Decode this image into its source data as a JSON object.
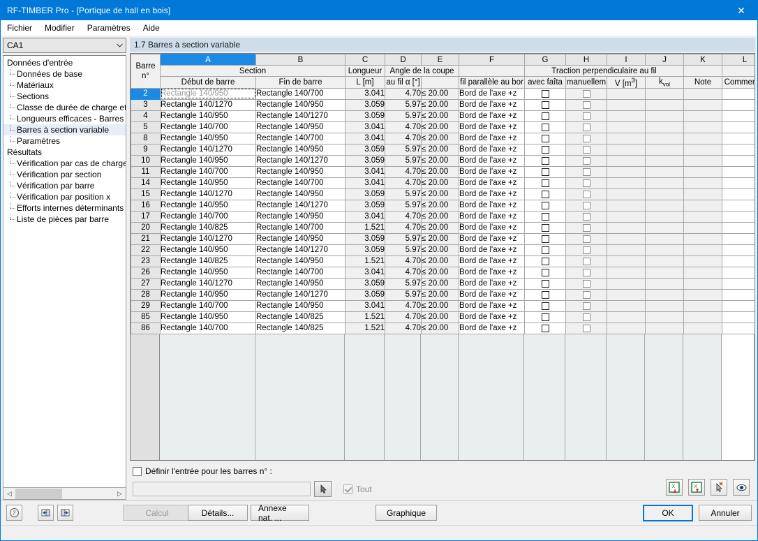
{
  "window": {
    "title": "RF-TIMBER Pro - [Portique de hall en bois]",
    "close_icon": "close-icon"
  },
  "menu": {
    "items": [
      {
        "label": "Fichier"
      },
      {
        "label": "Modifier"
      },
      {
        "label": "Paramètres"
      },
      {
        "label": "Aide"
      }
    ]
  },
  "sidebar": {
    "combo": {
      "value": "CA1",
      "arrow": "⌄"
    },
    "tree": [
      {
        "label": "Données d'entrée",
        "level": 0,
        "selected": false
      },
      {
        "label": "Données de base",
        "level": 1,
        "selected": false
      },
      {
        "label": "Matériaux",
        "level": 1,
        "selected": false
      },
      {
        "label": "Sections",
        "level": 1,
        "selected": false
      },
      {
        "label": "Classe de durée de charge et c",
        "level": 1,
        "selected": false
      },
      {
        "label": "Longueurs efficaces - Barres",
        "level": 1,
        "selected": false
      },
      {
        "label": "Barres à section variable",
        "level": 1,
        "selected": true
      },
      {
        "label": "Paramètres",
        "level": 1,
        "selected": false
      },
      {
        "label": "Résultats",
        "level": 0,
        "selected": false
      },
      {
        "label": "Vérification par cas de charge",
        "level": 1,
        "selected": false
      },
      {
        "label": "Vérification par section",
        "level": 1,
        "selected": false
      },
      {
        "label": "Vérification par barre",
        "level": 1,
        "selected": false
      },
      {
        "label": "Vérification par position x",
        "level": 1,
        "selected": false
      },
      {
        "label": "Efforts internes déterminants p",
        "level": 1,
        "selected": false
      },
      {
        "label": "Liste de pièces par barre",
        "level": 1,
        "selected": false
      }
    ]
  },
  "main": {
    "section_title": "1.7 Barres à section variable",
    "grid": {
      "column_letters": [
        "A",
        "B",
        "C",
        "D",
        "E",
        "F",
        "G",
        "H",
        "I",
        "J",
        "K",
        "L"
      ],
      "active_letter": "A",
      "corner_line1": "Barre",
      "corner_line2": "n°",
      "group_headers": {
        "section": "Section",
        "longueur": "Longueur",
        "angle": "Angle de la coupe",
        "traction": "Traction perpendiculaire au fil"
      },
      "sub_headers": {
        "debut": "Début de barre",
        "fin": "Fin de barre",
        "longueur_unit": "L [m]",
        "angle_unit": "au fil α [°]",
        "fil_parallele": "fil parallèle au bor",
        "avec_faita": "avec faîta",
        "manuellem": "manuellem",
        "volume": "V [m",
        "volume_sup": "3",
        "volume_end": "]",
        "kvol": "k",
        "kvol_sub": "vol",
        "note": "Note",
        "commentaire": "Commentai"
      },
      "rows": [
        {
          "no": "2",
          "debut": "Rectangle 140/950",
          "fin": "Rectangle 140/700",
          "longueur": "3.041",
          "angle": "4.70",
          "coupe": "≤ 20.00",
          "fil": "Bord de l'axe +z",
          "faita": false,
          "manuel": false,
          "v": "",
          "kvol": "",
          "note": "",
          "comment": "",
          "selected": true,
          "editing": true
        },
        {
          "no": "3",
          "debut": "Rectangle 140/1270",
          "fin": "Rectangle 140/950",
          "longueur": "3.059",
          "angle": "5.97",
          "coupe": "≤ 20.00",
          "fil": "Bord de l'axe +z",
          "faita": false,
          "manuel": false,
          "v": "",
          "kvol": "",
          "note": "",
          "comment": ""
        },
        {
          "no": "4",
          "debut": "Rectangle 140/950",
          "fin": "Rectangle 140/1270",
          "longueur": "3.059",
          "angle": "5.97",
          "coupe": "≤ 20.00",
          "fil": "Bord de l'axe +z",
          "faita": false,
          "manuel": false,
          "v": "",
          "kvol": "",
          "note": "",
          "comment": ""
        },
        {
          "no": "5",
          "debut": "Rectangle 140/700",
          "fin": "Rectangle 140/950",
          "longueur": "3.041",
          "angle": "4.70",
          "coupe": "≤ 20.00",
          "fil": "Bord de l'axe +z",
          "faita": false,
          "manuel": false,
          "v": "",
          "kvol": "",
          "note": "",
          "comment": ""
        },
        {
          "no": "8",
          "debut": "Rectangle 140/950",
          "fin": "Rectangle 140/700",
          "longueur": "3.041",
          "angle": "4.70",
          "coupe": "≤ 20.00",
          "fil": "Bord de l'axe +z",
          "faita": false,
          "manuel": false,
          "v": "",
          "kvol": "",
          "note": "",
          "comment": ""
        },
        {
          "no": "9",
          "debut": "Rectangle 140/1270",
          "fin": "Rectangle 140/950",
          "longueur": "3.059",
          "angle": "5.97",
          "coupe": "≤ 20.00",
          "fil": "Bord de l'axe +z",
          "faita": false,
          "manuel": false,
          "v": "",
          "kvol": "",
          "note": "",
          "comment": ""
        },
        {
          "no": "10",
          "debut": "Rectangle 140/950",
          "fin": "Rectangle 140/1270",
          "longueur": "3.059",
          "angle": "5.97",
          "coupe": "≤ 20.00",
          "fil": "Bord de l'axe +z",
          "faita": false,
          "manuel": false,
          "v": "",
          "kvol": "",
          "note": "",
          "comment": ""
        },
        {
          "no": "11",
          "debut": "Rectangle 140/700",
          "fin": "Rectangle 140/950",
          "longueur": "3.041",
          "angle": "4.70",
          "coupe": "≤ 20.00",
          "fil": "Bord de l'axe +z",
          "faita": false,
          "manuel": false,
          "v": "",
          "kvol": "",
          "note": "",
          "comment": ""
        },
        {
          "no": "14",
          "debut": "Rectangle 140/950",
          "fin": "Rectangle 140/700",
          "longueur": "3.041",
          "angle": "4.70",
          "coupe": "≤ 20.00",
          "fil": "Bord de l'axe +z",
          "faita": false,
          "manuel": false,
          "v": "",
          "kvol": "",
          "note": "",
          "comment": ""
        },
        {
          "no": "15",
          "debut": "Rectangle 140/1270",
          "fin": "Rectangle 140/950",
          "longueur": "3.059",
          "angle": "5.97",
          "coupe": "≤ 20.00",
          "fil": "Bord de l'axe +z",
          "faita": false,
          "manuel": false,
          "v": "",
          "kvol": "",
          "note": "",
          "comment": ""
        },
        {
          "no": "16",
          "debut": "Rectangle 140/950",
          "fin": "Rectangle 140/1270",
          "longueur": "3.059",
          "angle": "5.97",
          "coupe": "≤ 20.00",
          "fil": "Bord de l'axe +z",
          "faita": false,
          "manuel": false,
          "v": "",
          "kvol": "",
          "note": "",
          "comment": ""
        },
        {
          "no": "17",
          "debut": "Rectangle 140/700",
          "fin": "Rectangle 140/950",
          "longueur": "3.041",
          "angle": "4.70",
          "coupe": "≤ 20.00",
          "fil": "Bord de l'axe +z",
          "faita": false,
          "manuel": false,
          "v": "",
          "kvol": "",
          "note": "",
          "comment": ""
        },
        {
          "no": "20",
          "debut": "Rectangle 140/825",
          "fin": "Rectangle 140/700",
          "longueur": "1.521",
          "angle": "4.70",
          "coupe": "≤ 20.00",
          "fil": "Bord de l'axe +z",
          "faita": false,
          "manuel": false,
          "v": "",
          "kvol": "",
          "note": "",
          "comment": ""
        },
        {
          "no": "21",
          "debut": "Rectangle 140/1270",
          "fin": "Rectangle 140/950",
          "longueur": "3.059",
          "angle": "5.97",
          "coupe": "≤ 20.00",
          "fil": "Bord de l'axe +z",
          "faita": false,
          "manuel": false,
          "v": "",
          "kvol": "",
          "note": "",
          "comment": ""
        },
        {
          "no": "22",
          "debut": "Rectangle 140/950",
          "fin": "Rectangle 140/1270",
          "longueur": "3.059",
          "angle": "5.97",
          "coupe": "≤ 20.00",
          "fil": "Bord de l'axe +z",
          "faita": false,
          "manuel": false,
          "v": "",
          "kvol": "",
          "note": "",
          "comment": ""
        },
        {
          "no": "23",
          "debut": "Rectangle 140/825",
          "fin": "Rectangle 140/950",
          "longueur": "1.521",
          "angle": "4.70",
          "coupe": "≤ 20.00",
          "fil": "Bord de l'axe +z",
          "faita": false,
          "manuel": false,
          "v": "",
          "kvol": "",
          "note": "",
          "comment": ""
        },
        {
          "no": "26",
          "debut": "Rectangle 140/950",
          "fin": "Rectangle 140/700",
          "longueur": "3.041",
          "angle": "4.70",
          "coupe": "≤ 20.00",
          "fil": "Bord de l'axe +z",
          "faita": false,
          "manuel": false,
          "v": "",
          "kvol": "",
          "note": "",
          "comment": ""
        },
        {
          "no": "27",
          "debut": "Rectangle 140/1270",
          "fin": "Rectangle 140/950",
          "longueur": "3.059",
          "angle": "5.97",
          "coupe": "≤ 20.00",
          "fil": "Bord de l'axe +z",
          "faita": false,
          "manuel": false,
          "v": "",
          "kvol": "",
          "note": "",
          "comment": ""
        },
        {
          "no": "28",
          "debut": "Rectangle 140/950",
          "fin": "Rectangle 140/1270",
          "longueur": "3.059",
          "angle": "5.97",
          "coupe": "≤ 20.00",
          "fil": "Bord de l'axe +z",
          "faita": false,
          "manuel": false,
          "v": "",
          "kvol": "",
          "note": "",
          "comment": ""
        },
        {
          "no": "29",
          "debut": "Rectangle 140/700",
          "fin": "Rectangle 140/950",
          "longueur": "3.041",
          "angle": "4.70",
          "coupe": "≤ 20.00",
          "fil": "Bord de l'axe +z",
          "faita": false,
          "manuel": false,
          "v": "",
          "kvol": "",
          "note": "",
          "comment": ""
        },
        {
          "no": "85",
          "debut": "Rectangle 140/950",
          "fin": "Rectangle 140/825",
          "longueur": "1.521",
          "angle": "4.70",
          "coupe": "≤ 20.00",
          "fil": "Bord de l'axe +z",
          "faita": false,
          "manuel": false,
          "v": "",
          "kvol": "",
          "note": "",
          "comment": ""
        },
        {
          "no": "86",
          "debut": "Rectangle 140/700",
          "fin": "Rectangle 140/825",
          "longueur": "1.521",
          "angle": "4.70",
          "coupe": "≤ 20.00",
          "fil": "Bord de l'axe +z",
          "faita": false,
          "manuel": false,
          "v": "",
          "kvol": "",
          "note": "",
          "comment": ""
        }
      ]
    },
    "options": {
      "define_entry_label": "Définir l'entrée pour les barres n° :",
      "define_entry_checked": false,
      "bars_input_value": "",
      "bars_input_placeholder": "",
      "pick_icon": "pick-cursor-icon",
      "tout_label": "Tout",
      "tout_checked": true,
      "action_icons": [
        {
          "name": "export-excel-up-icon"
        },
        {
          "name": "import-excel-down-icon"
        },
        {
          "name": "pick-in-model-icon"
        },
        {
          "name": "visibility-eye-icon"
        }
      ]
    }
  },
  "footer": {
    "icon_buttons": [
      {
        "name": "help-icon"
      },
      {
        "name": "previous-panel-icon"
      },
      {
        "name": "next-panel-icon"
      }
    ],
    "buttons": [
      {
        "label": "Calcul",
        "state": "disabled",
        "name": "calcul-button"
      },
      {
        "label": "Détails...",
        "state": "normal",
        "name": "details-button"
      },
      {
        "label": "Annexe nat. ...",
        "state": "normal",
        "name": "annexe-nat-button"
      },
      {
        "label": "Graphique",
        "state": "normal",
        "name": "graphique-button"
      }
    ],
    "ok_label": "OK",
    "cancel_label": "Annuler"
  },
  "colors": {
    "accent": "#0078d7",
    "header_selected": "#1a8ae5",
    "section_title_bg": "#cfdcea",
    "tree_selected_bg": "#e8eef7"
  }
}
